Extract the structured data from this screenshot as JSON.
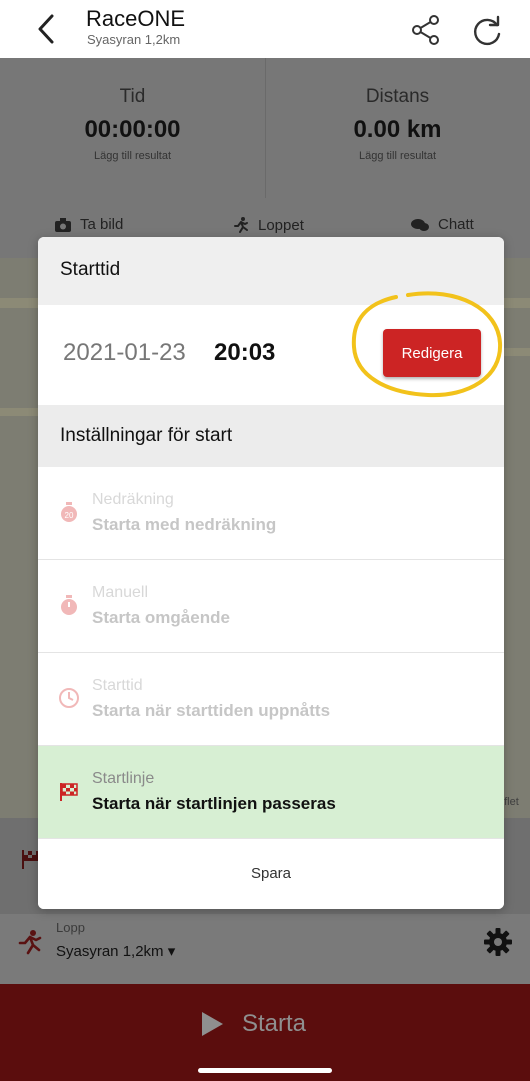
{
  "header": {
    "title": "RaceONE",
    "subtitle": "Syasyran 1,2km"
  },
  "stats": {
    "time": {
      "label": "Tid",
      "value": "00:00:00",
      "action": "Lägg till resultat"
    },
    "distance": {
      "label": "Distans",
      "value": "0.00 km",
      "action": "Lägg till resultat"
    }
  },
  "tabs": [
    {
      "label": "Ta bild",
      "icon": "camera-icon"
    },
    {
      "label": "Loppet",
      "icon": "runner-icon"
    },
    {
      "label": "Chatt",
      "icon": "chat-icon"
    }
  ],
  "map": {
    "attribution": "aflet"
  },
  "race": {
    "label": "Lopp",
    "value": "Syasyran 1,2km ▾"
  },
  "start_button": {
    "label": "Starta"
  },
  "modal": {
    "title": "Starttid",
    "date": "2021-01-23",
    "time": "20:03",
    "edit_label": "Redigera",
    "settings_title": "Inställningar för start",
    "options": [
      {
        "title": "Nedräkning",
        "description": "Starta med nedräkning",
        "icon": "countdown-icon",
        "selected": false
      },
      {
        "title": "Manuell",
        "description": "Starta omgående",
        "icon": "stopwatch-icon",
        "selected": false
      },
      {
        "title": "Starttid",
        "description": "Starta när starttiden uppnåtts",
        "icon": "clock-icon",
        "selected": false
      },
      {
        "title": "Startlinje",
        "description": "Starta när startlinjen passeras",
        "icon": "checkered-flag-icon",
        "selected": true
      }
    ],
    "save_label": "Spara"
  },
  "colors": {
    "accent_red": "#cc2424",
    "start_bar": "#5b0d0d",
    "selected_option": "#d7efd3",
    "highlight_circle": "#f2c21b"
  }
}
